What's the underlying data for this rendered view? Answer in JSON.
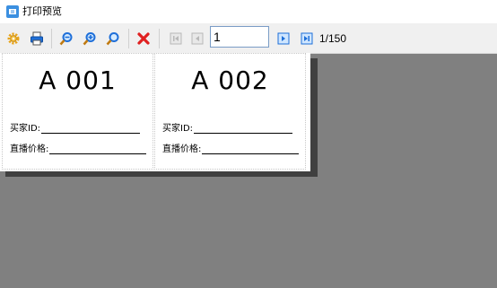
{
  "window": {
    "title": "打印预览"
  },
  "toolbar": {
    "current_page": "1",
    "page_count": "1/150",
    "icons": {
      "settings": "gear-icon",
      "print": "printer-icon",
      "zoom_out": "zoom-out-icon",
      "zoom_in": "zoom-in-icon",
      "zoom_fit": "zoom-fit-icon",
      "close": "close-icon",
      "first": "first-page-icon",
      "prev": "previous-page-icon",
      "next": "next-page-icon",
      "last": "last-page-icon"
    },
    "colors": {
      "gear": "#e8a317",
      "blue": "#1e6fd9",
      "red": "#e02020",
      "disabled": "#b8b8b8"
    }
  },
  "labels": [
    {
      "code": "A 001",
      "buyer_id_label": "买家ID:",
      "price_label": "直播价格:"
    },
    {
      "code": "A 002",
      "buyer_id_label": "买家ID:",
      "price_label": "直播价格:"
    }
  ]
}
